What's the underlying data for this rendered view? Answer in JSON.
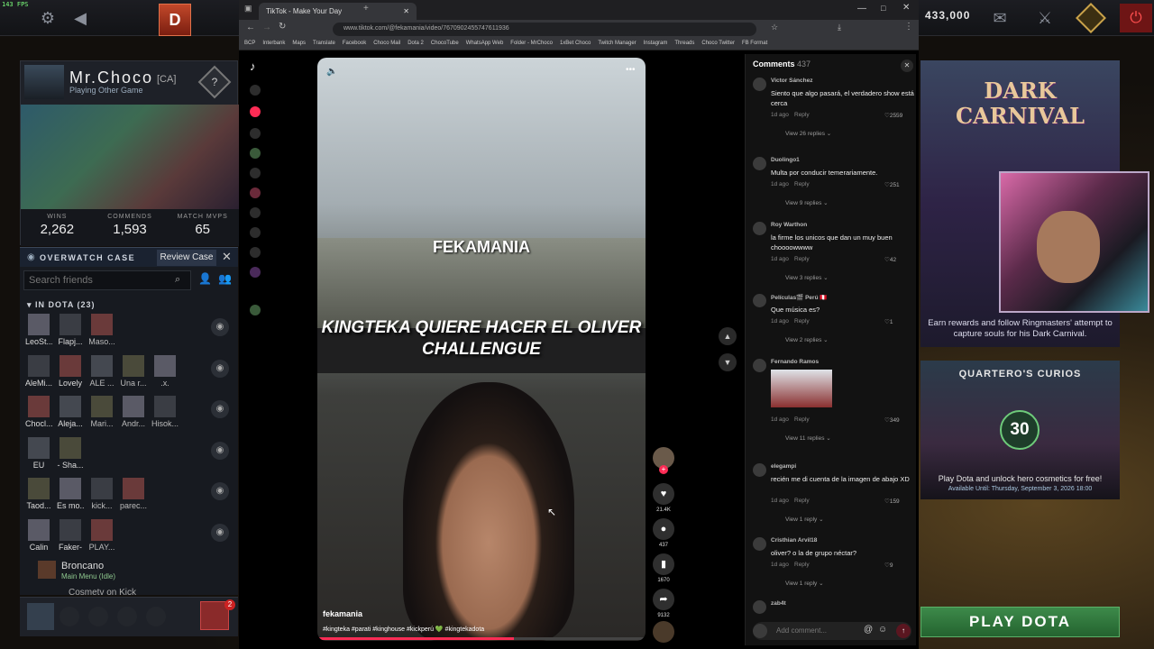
{
  "fps": "143 FPS",
  "currency": "433,000",
  "profile": {
    "name": "Mr.Choco",
    "tag": "[CA]",
    "status": "Playing Other Game",
    "logo": "?",
    "stats": [
      {
        "label": "WINS",
        "value": "2,262"
      },
      {
        "label": "COMMENDS",
        "value": "1,593"
      },
      {
        "label": "MATCH MVPS",
        "value": "65"
      }
    ]
  },
  "overwatch": {
    "label": "OVERWATCH CASE",
    "button": "Review Case"
  },
  "friends": {
    "search_placeholder": "Search friends",
    "header": "IN DOTA (23)",
    "rows": [
      [
        "LeoSt...",
        "Flapj...",
        "Maso..."
      ],
      [
        "AleMi...",
        "Lovely",
        "ALE ...",
        "Una r...",
        ".x."
      ],
      [
        "Chocl...",
        "Aleja...",
        "Mari...",
        "Andr...",
        "Hisok..."
      ],
      [
        "EU",
        "- Sha..."
      ],
      [
        "Taod...",
        "Es mo...",
        "kick...",
        "parec..."
      ],
      [
        "Calin",
        "Faker-",
        "PLAY..."
      ]
    ],
    "broncano": {
      "name": "Broncano",
      "status": "Main Menu (Idle)",
      "next": "Cosmetv on Kick"
    }
  },
  "party_badge": "2",
  "browser": {
    "tab_title": "TikTok - Make Your Day",
    "url": "www.tiktok.com/@fekamania/video/7670902455747611936",
    "bookmarks": [
      "BCP",
      "Interbank",
      "Maps",
      "Translate",
      "Facebook",
      "Choco Mail",
      "Dota 2",
      "ChocoTube",
      "WhatsApp Web",
      "Folder - MrChoco",
      "1xBet Choco",
      "Twitch Manager",
      "Instagram",
      "Threads",
      "Choco Twitter",
      "FB Format"
    ]
  },
  "video": {
    "caption_top": "FEKAMANIA",
    "caption_main": "KINGTEKA QUIERE HACER EL OLIVER CHALLENGUE",
    "user": "fekamania",
    "tags": "#kingteka #parati #kinghouse #kickperú 💚 #kingtekadota",
    "progress": 0.6
  },
  "actions": {
    "likes": "21.4K",
    "comments": "437",
    "saves": "1670",
    "shares": "9132"
  },
  "comments": {
    "title": "Comments",
    "count": "437",
    "input_placeholder": "Add comment...",
    "items": [
      {
        "user": "Victor Sánchez",
        "text": "Siento que algo pasará, el verdadero show está cerca",
        "time": "1d ago",
        "reply": "Reply",
        "likes": "2559",
        "view": "View 26 replies"
      },
      {
        "user": "Duolingo1",
        "text": "Multa por conducir temerariamente.",
        "time": "1d ago",
        "reply": "Reply",
        "likes": "251",
        "view": "View 9 replies"
      },
      {
        "user": "Roy Warthon",
        "text": "la firme los unicos que dan un muy buen choooowwww",
        "time": "1d ago",
        "reply": "Reply",
        "likes": "42",
        "view": "View 3 replies"
      },
      {
        "user": "Películas🎬 Perú 🇵🇪",
        "text": "Que música es?",
        "time": "1d ago",
        "reply": "Reply",
        "likes": "1",
        "view": "View 2 replies"
      },
      {
        "user": "Fernando Ramos",
        "text": "",
        "time": "1d ago",
        "reply": "Reply",
        "likes": "349",
        "view": "View 11 replies"
      },
      {
        "user": "elegampi",
        "text": "recién me di cuenta de la imagen de abajo XD",
        "time": "1d ago",
        "reply": "Reply",
        "likes": "159",
        "view": "View 1 reply"
      },
      {
        "user": "Cristhian Arvil18",
        "text": "oliver? o la de grupo néctar?",
        "time": "1d ago",
        "reply": "Reply",
        "likes": "9",
        "view": "View 1 reply"
      },
      {
        "user": "zab4t",
        "text": "",
        "time": "",
        "reply": "",
        "likes": "",
        "view": ""
      }
    ]
  },
  "carnival": {
    "title": "DARK CARNIVAL",
    "desc": "Earn rewards and follow Ringmasters' attempt to capture souls for his Dark Carnival."
  },
  "curios": {
    "title": "QUARTERO'S CURIOS",
    "count": "30",
    "desc": "Play Dota and unlock hero cosmetics for free!",
    "until": "Available Until:  Thursday, September 3, 2026 18:00"
  },
  "play_button": "PLAY DOTA"
}
